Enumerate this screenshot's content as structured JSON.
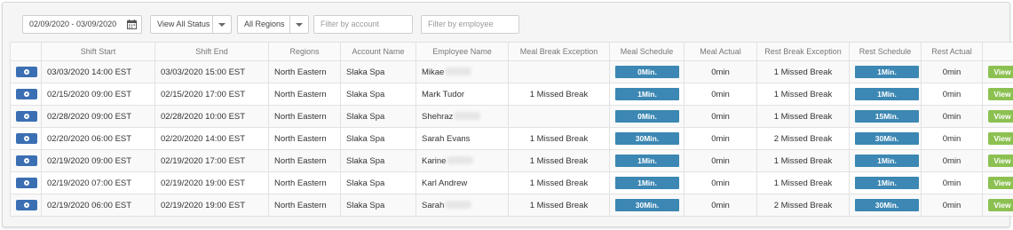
{
  "filters": {
    "date_range": "02/09/2020 - 03/09/2020",
    "status_select": "View All Status",
    "region_select": "All Regions",
    "account_placeholder": "Filter by account",
    "employee_placeholder": "Filter by employee"
  },
  "colors": {
    "action_button": "#3b6fb3",
    "schedule_badge": "#3c87b3",
    "view_button": "#8cc152"
  },
  "table": {
    "headers": [
      "",
      "Shift Start",
      "Shift End",
      "Regions",
      "Account Name",
      "Employee Name",
      "Meal Break Exception",
      "Meal Schedule",
      "Meal Actual",
      "Rest Break Exception",
      "Rest Schedule",
      "Rest Actual",
      ""
    ],
    "view_label": "View",
    "rows": [
      {
        "shift_start": "03/03/2020 14:00 EST",
        "shift_end": "03/03/2020 15:00 EST",
        "region": "North Eastern",
        "account": "Slaka Spa",
        "employee": "Mikae",
        "employee_obscured": true,
        "meal_exception": "",
        "meal_schedule": "0Min.",
        "meal_actual": "0min",
        "rest_exception": "1 Missed Break",
        "rest_schedule": "1Min.",
        "rest_actual": "0min"
      },
      {
        "shift_start": "02/15/2020 09:00 EST",
        "shift_end": "02/15/2020 17:00 EST",
        "region": "North Eastern",
        "account": "Slaka Spa",
        "employee": "Mark Tudor",
        "employee_obscured": false,
        "meal_exception": "1 Missed Break",
        "meal_schedule": "1Min.",
        "meal_actual": "0min",
        "rest_exception": "1 Missed Break",
        "rest_schedule": "1Min.",
        "rest_actual": "0min"
      },
      {
        "shift_start": "02/28/2020 09:00 EST",
        "shift_end": "02/28/2020 10:00 EST",
        "region": "North Eastern",
        "account": "Slaka Spa",
        "employee": "Shehraz",
        "employee_obscured": true,
        "meal_exception": "",
        "meal_schedule": "0Min.",
        "meal_actual": "0min",
        "rest_exception": "1 Missed Break",
        "rest_schedule": "15Min.",
        "rest_actual": "0min"
      },
      {
        "shift_start": "02/20/2020 06:00 EST",
        "shift_end": "02/20/2020 14:00 EST",
        "region": "North Eastern",
        "account": "Slaka Spa",
        "employee": "Sarah Evans",
        "employee_obscured": false,
        "meal_exception": "1 Missed Break",
        "meal_schedule": "30Min.",
        "meal_actual": "0min",
        "rest_exception": "2 Missed Break",
        "rest_schedule": "30Min.",
        "rest_actual": "0min"
      },
      {
        "shift_start": "02/19/2020 09:00 EST",
        "shift_end": "02/19/2020 17:00 EST",
        "region": "North Eastern",
        "account": "Slaka Spa",
        "employee": "Karine",
        "employee_obscured": true,
        "meal_exception": "1 Missed Break",
        "meal_schedule": "1Min.",
        "meal_actual": "0min",
        "rest_exception": "1 Missed Break",
        "rest_schedule": "1Min.",
        "rest_actual": "0min"
      },
      {
        "shift_start": "02/19/2020 07:00 EST",
        "shift_end": "02/19/2020 19:00 EST",
        "region": "North Eastern",
        "account": "Slaka Spa",
        "employee": "Karl Andrew",
        "employee_obscured": false,
        "meal_exception": "1 Missed Break",
        "meal_schedule": "1Min.",
        "meal_actual": "0min",
        "rest_exception": "1 Missed Break",
        "rest_schedule": "1Min.",
        "rest_actual": "0min"
      },
      {
        "shift_start": "02/19/2020 06:00 EST",
        "shift_end": "02/19/2020 19:00 EST",
        "region": "North Eastern",
        "account": "Slaka Spa",
        "employee": "Sarah",
        "employee_obscured": true,
        "meal_exception": "1 Missed Break",
        "meal_schedule": "30Min.",
        "meal_actual": "0min",
        "rest_exception": "2 Missed Break",
        "rest_schedule": "30Min.",
        "rest_actual": "0min"
      }
    ]
  }
}
